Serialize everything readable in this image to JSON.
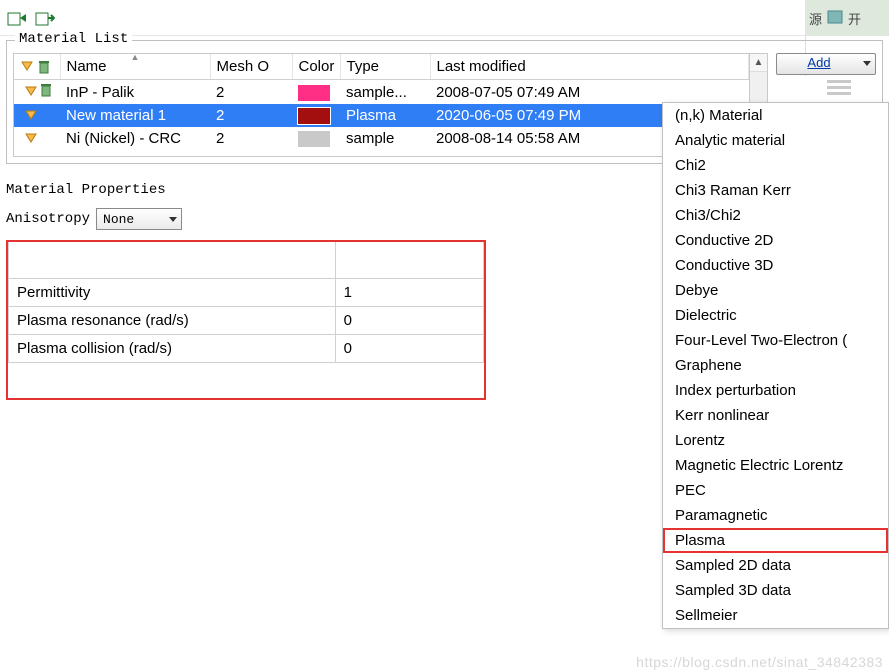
{
  "right_fragment": {
    "text1": "源",
    "text2": "开"
  },
  "material_list": {
    "label": "Material List",
    "columns": [
      "Name",
      "Mesh O",
      "Color",
      "Type",
      "Last modified"
    ],
    "rows": [
      {
        "trash": true,
        "name": "InP - Palik",
        "mesh": "2",
        "color": "#ff2f86",
        "type": "sample...",
        "modified": "2008-07-05 07:49 AM",
        "selected": false
      },
      {
        "trash": false,
        "name": "New material 1",
        "mesh": "2",
        "color": "#a30e0e",
        "type": "Plasma",
        "modified": "2020-06-05 07:49 PM",
        "selected": true
      },
      {
        "trash": false,
        "name": "Ni (Nickel) - CRC",
        "mesh": "2",
        "color": "#c9c9c9",
        "type": "sample",
        "modified": "2008-08-14 05:58 AM",
        "selected": false
      }
    ],
    "add_label": "Add"
  },
  "add_menu": {
    "items": [
      "(n,k) Material",
      "Analytic material",
      "Chi2",
      "Chi3 Raman Kerr",
      "Chi3/Chi2",
      "Conductive 2D",
      "Conductive 3D",
      "Debye",
      "Dielectric",
      "Four-Level Two-Electron (",
      "Graphene",
      "Index perturbation",
      "Kerr nonlinear",
      "Lorentz",
      "Magnetic Electric Lorentz",
      "PEC",
      "Paramagnetic",
      "Plasma",
      "Sampled 2D data",
      "Sampled 3D data",
      "Sellmeier"
    ],
    "highlight_index": 17
  },
  "properties": {
    "title": "Material Properties",
    "anisotropy_label": "Anisotropy",
    "anisotropy_value": "None",
    "rows": [
      {
        "label": "Permittivity",
        "value": "1"
      },
      {
        "label": "Plasma resonance (rad/s)",
        "value": "0"
      },
      {
        "label": "Plasma collision (rad/s)",
        "value": "0"
      }
    ]
  },
  "watermark": "https://blog.csdn.net/sinat_34842383"
}
